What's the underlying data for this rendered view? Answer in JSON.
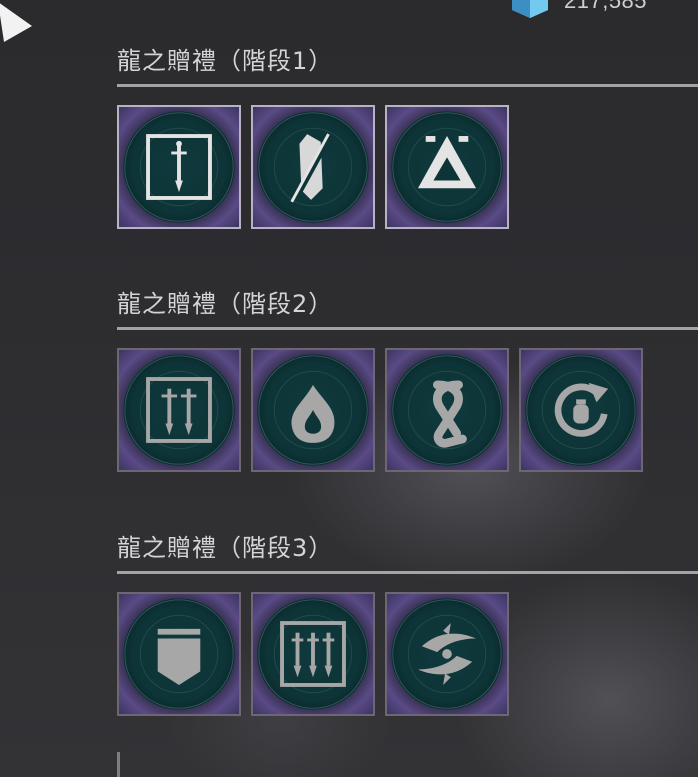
{
  "currency": {
    "amount": "217,585",
    "icon": "glimmer-cube-icon"
  },
  "sections": [
    {
      "title": "龍之贈禮（階段1）",
      "items": [
        {
          "icon": "sword-frame-icon",
          "unlocked": true
        },
        {
          "icon": "crystal-shard-icon",
          "unlocked": true
        },
        {
          "icon": "triangle-sigil-icon",
          "unlocked": true
        }
      ]
    },
    {
      "title": "龍之贈禮（階段2）",
      "items": [
        {
          "icon": "double-sword-frame-icon",
          "unlocked": false
        },
        {
          "icon": "flame-drop-icon",
          "unlocked": false
        },
        {
          "icon": "knot-rune-icon",
          "unlocked": false
        },
        {
          "icon": "grenade-refresh-icon",
          "unlocked": false
        }
      ]
    },
    {
      "title": "龍之贈禮（階段3）",
      "items": [
        {
          "icon": "banner-shield-icon",
          "unlocked": false
        },
        {
          "icon": "triple-sword-frame-icon",
          "unlocked": false
        },
        {
          "icon": "spiral-blades-icon",
          "unlocked": false
        }
      ]
    }
  ],
  "colors": {
    "tile_core": "#0d3437",
    "tile_ring": "#5a4a86",
    "tile_border_unlocked": "#b8b2c4",
    "tile_border_locked": "#6f6673",
    "glyph_bright": "#e4e4e4",
    "glyph_dim": "#a7a7a7"
  }
}
